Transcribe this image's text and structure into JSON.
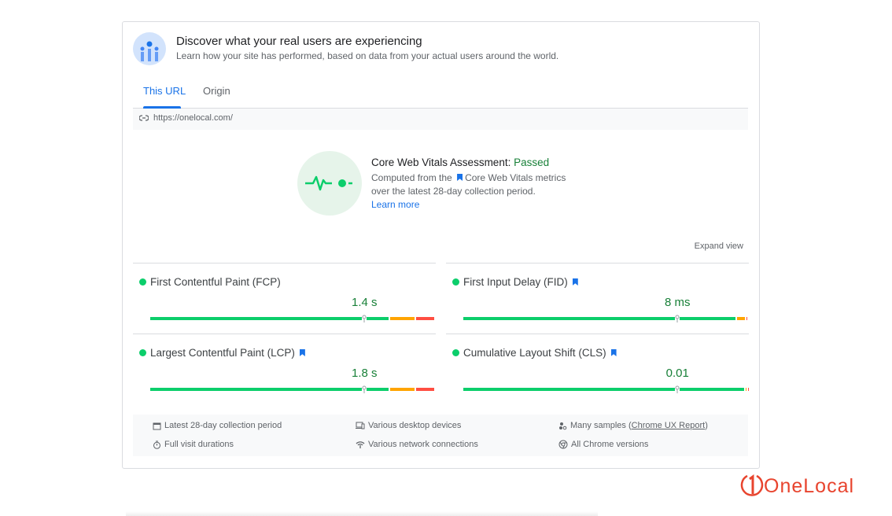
{
  "header": {
    "title": "Discover what your real users are experiencing",
    "subtitle": "Learn how your site has performed, based on data from your actual users around the world.",
    "icon": "users-icon"
  },
  "tabs": [
    {
      "label": "This URL",
      "active": true
    },
    {
      "label": "Origin",
      "active": false
    }
  ],
  "url": "https://onelocal.com/",
  "assessment": {
    "label": "Core Web Vitals Assessment: ",
    "status": "Passed",
    "line1_a": "Computed from the",
    "line1_b": "Core Web Vitals metrics",
    "line2": "over the latest 28-day collection period.",
    "learn_more": "Learn more"
  },
  "expand_view": "Expand view",
  "colors": {
    "good": "#0cce6b",
    "needs_improvement": "#ffa400",
    "poor": "#ff4e42",
    "accent": "#1a73e8",
    "pass": "#188038"
  },
  "metrics": [
    {
      "name": "First Contentful Paint (FCP)",
      "value": "1.4 s",
      "core": false,
      "dist": [
        84,
        9,
        7
      ],
      "marker": 75
    },
    {
      "name": "First Input Delay (FID)",
      "value": "8 ms",
      "core": true,
      "dist": [
        96,
        3.3,
        0.7
      ],
      "marker": 75
    },
    {
      "name": "Largest Contentful Paint (LCP)",
      "value": "1.8 s",
      "core": true,
      "dist": [
        84,
        9,
        7
      ],
      "marker": 75
    },
    {
      "name": "Cumulative Layout Shift (CLS)",
      "value": "0.01",
      "core": true,
      "dist": [
        99,
        0.7,
        0.3
      ],
      "marker": 75
    }
  ],
  "footer": {
    "period": "Latest 28-day collection period",
    "devices": "Various desktop devices",
    "samples_a": "Many samples (",
    "samples_link": "Chrome UX Report",
    "samples_b": ")",
    "durations": "Full visit durations",
    "network": "Various network connections",
    "chrome": "All Chrome versions"
  },
  "logo": {
    "text": "OneLocal"
  }
}
